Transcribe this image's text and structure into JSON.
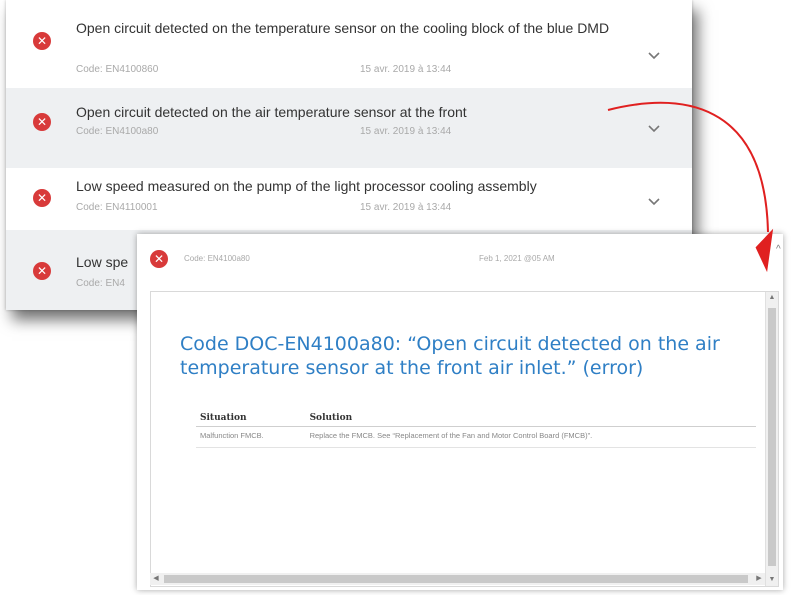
{
  "errors": [
    {
      "title": "Open circuit detected on the temperature sensor on the cooling block of the blue DMD",
      "code": "Code: EN4100860",
      "date": "15 avr. 2019 à 13:44"
    },
    {
      "title": "Open circuit detected on the air temperature sensor at the front",
      "code": "Code: EN4100a80",
      "date": "15 avr. 2019 à 13:44"
    },
    {
      "title": "Low speed measured on the pump of the light processor cooling assembly",
      "code": "Code: EN4110001",
      "date": "15 avr. 2019 à 13:44"
    },
    {
      "title": "Low spe",
      "code": "Code: EN4"
    }
  ],
  "detail": {
    "code": "Code: EN4100a80",
    "date": "Feb 1, 2021 @05 AM",
    "doc_title": "Code DOC-EN4100a80: “Open circuit detected on the air temperature sensor at the front air inlet.” (error)",
    "table": {
      "headers": [
        "Situation",
        "Solution"
      ],
      "rows": [
        {
          "situation": "Malfunction FMCB.",
          "solution": "Replace the FMCB. See “Replacement of the Fan and Motor Control Board (FMCB)”."
        }
      ]
    }
  },
  "colors": {
    "error_red": "#d83a3a",
    "callout_red": "#e02020",
    "doc_title_blue": "#2f7fc5",
    "row_alt_bg": "#eef0f2"
  },
  "icons": {
    "error": "close-circle-icon",
    "expand": "chevron-down-icon",
    "collapse": "chevron-up-icon"
  }
}
